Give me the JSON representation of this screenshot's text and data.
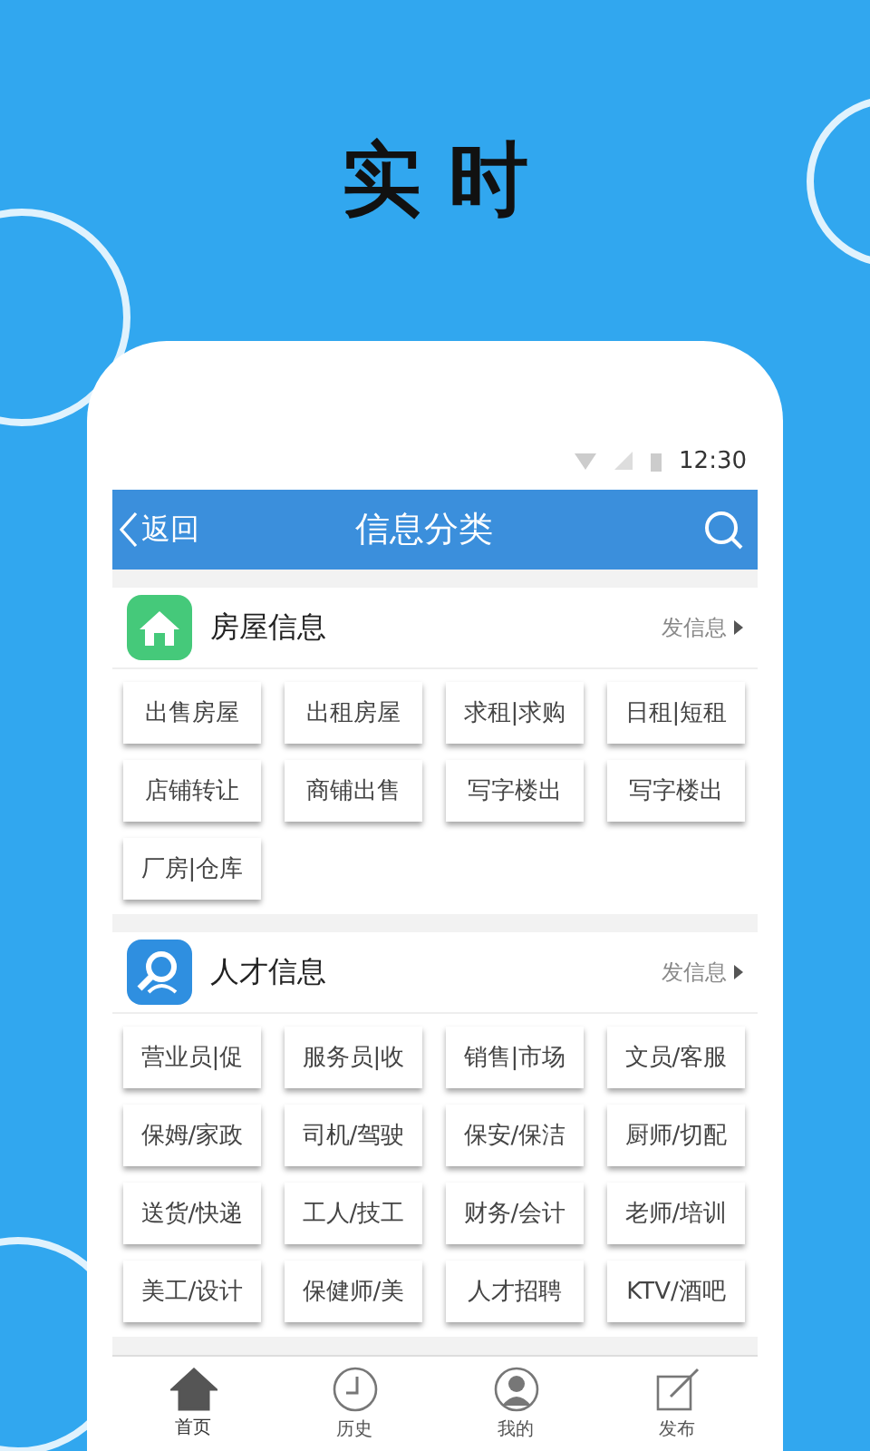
{
  "headline": "实 时",
  "status_bar": {
    "time": "12:30"
  },
  "nav": {
    "back": "返回",
    "title": "信息分类"
  },
  "sections": [
    {
      "kind": "house",
      "title": "房屋信息",
      "action": "发信息",
      "items": [
        "出售房屋",
        "出租房屋",
        "求租|求购",
        "日租|短租",
        "店铺转让",
        "商铺出售",
        "写字楼出",
        "写字楼出",
        "厂房|仓库"
      ]
    },
    {
      "kind": "talent",
      "title": "人才信息",
      "action": "发信息",
      "items": [
        "营业员|促",
        "服务员|收",
        "销售|市场",
        "文员/客服",
        "保姆/家政",
        "司机/驾驶",
        "保安/保洁",
        "厨师/切配",
        "送货/快递",
        "工人/技工",
        "财务/会计",
        "老师/培训",
        "美工/设计",
        "保健师/美",
        "人才招聘",
        "KTV/酒吧"
      ]
    }
  ],
  "tabs": [
    {
      "kind": "home",
      "label": "首页",
      "selected": true
    },
    {
      "kind": "history",
      "label": "历史",
      "selected": false
    },
    {
      "kind": "profile",
      "label": "我的",
      "selected": false
    },
    {
      "kind": "publish",
      "label": "发布",
      "selected": false
    }
  ]
}
